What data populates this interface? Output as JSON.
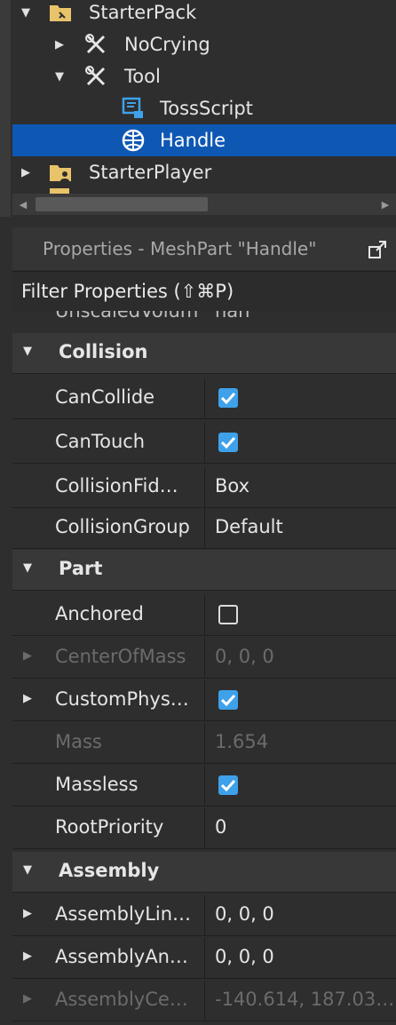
{
  "explorer": {
    "items": [
      {
        "label": "StarterPack",
        "icon": "starterpack-folder-icon",
        "expanded": true
      },
      {
        "label": "NoCrying",
        "icon": "tool-icon",
        "expanded": false
      },
      {
        "label": "Tool",
        "icon": "tool-icon",
        "expanded": true
      },
      {
        "label": "TossScript",
        "icon": "script-icon"
      },
      {
        "label": "Handle",
        "icon": "meshpart-icon",
        "selected": true
      },
      {
        "label": "StarterPlayer",
        "icon": "starterplayer-folder-icon",
        "expanded": false
      }
    ]
  },
  "properties": {
    "title": "Properties - MeshPart \"Handle\"",
    "filter_placeholder": "Filter Properties (⇧⌘P)",
    "clipped_row": {
      "name": "UnscaledVolum",
      "value": "nan"
    },
    "categories": {
      "collision": "Collision",
      "part": "Part",
      "assembly": "Assembly"
    },
    "rows": {
      "cancollide": {
        "name": "CanCollide",
        "checked": true
      },
      "cantouch": {
        "name": "CanTouch",
        "checked": true
      },
      "collisionfidelity": {
        "name": "CollisionFid…",
        "value": "Box"
      },
      "collisiongroup": {
        "name": "CollisionGroup",
        "value": "Default"
      },
      "anchored": {
        "name": "Anchored",
        "checked": false
      },
      "centerofmass": {
        "name": "CenterOfMass",
        "value": "0, 0, 0"
      },
      "customphysical": {
        "name": "CustomPhys…",
        "checked": true
      },
      "mass": {
        "name": "Mass",
        "value": "1.654"
      },
      "massless": {
        "name": "Massless",
        "checked": true
      },
      "rootpriority": {
        "name": "RootPriority",
        "value": "0"
      },
      "assemblylinear": {
        "name": "AssemblyLin…",
        "value": "0, 0, 0"
      },
      "assemblyangular": {
        "name": "AssemblyAn…",
        "value": "0, 0, 0"
      },
      "assemblycenter": {
        "name": "AssemblyCe…",
        "value": "-140.614, 187.03…"
      }
    }
  },
  "colors": {
    "selection": "#0e58b4",
    "checkbox": "#3ea1ea",
    "background": "#2e2e2e"
  }
}
